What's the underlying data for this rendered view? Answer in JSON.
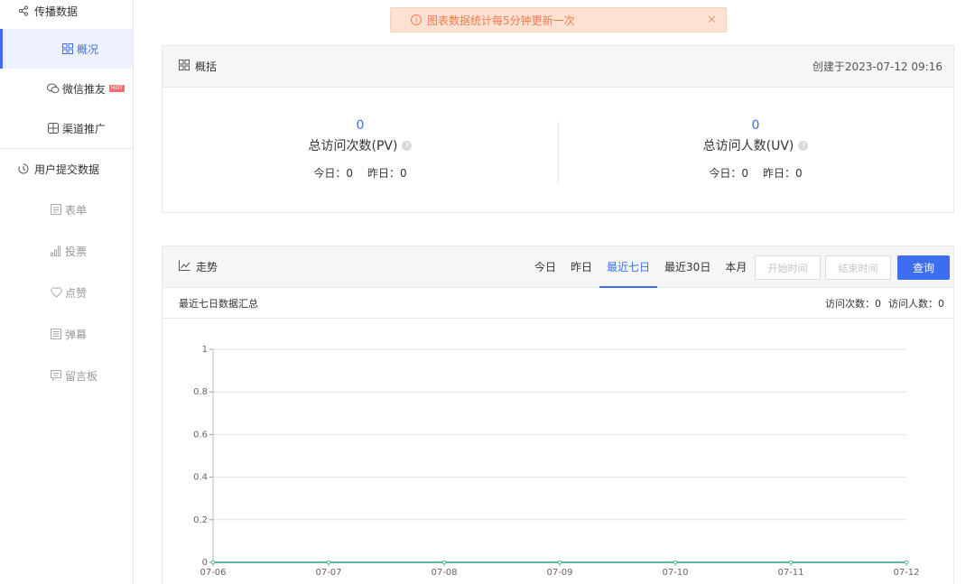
{
  "sidebar": {
    "section1": {
      "label": "传播数据",
      "icon": "share-icon"
    },
    "items1": [
      {
        "label": "概况",
        "icon": "grid-icon",
        "active": true
      },
      {
        "label": "微信推友",
        "icon": "wechat-icon",
        "badge": "HOT"
      },
      {
        "label": "渠道推广",
        "icon": "channel-icon"
      }
    ],
    "section2": {
      "label": "用户提交数据",
      "icon": "clock-icon"
    },
    "items2": [
      {
        "label": "表单",
        "icon": "form-icon"
      },
      {
        "label": "投票",
        "icon": "bar-chart-icon"
      },
      {
        "label": "点赞",
        "icon": "heart-icon"
      },
      {
        "label": "弹幕",
        "icon": "barrage-icon"
      },
      {
        "label": "留言板",
        "icon": "message-icon"
      }
    ]
  },
  "notice": {
    "text": "图表数据统计每5分钟更新一次"
  },
  "overview": {
    "title": "概括",
    "created": "创建于2023-07-12 09:16",
    "pv": {
      "value": "0",
      "label": "总访问次数(PV)",
      "today": "今日：0",
      "yesterday": "昨日：0"
    },
    "uv": {
      "value": "0",
      "label": "总访问人数(UV)",
      "today": "今日：0",
      "yesterday": "昨日：0"
    }
  },
  "trend": {
    "title": "走势",
    "ranges": [
      "今日",
      "昨日",
      "最近七日",
      "最近30日",
      "本月"
    ],
    "active_range": "最近七日",
    "start_placeholder": "开始时间",
    "end_placeholder": "结束时间",
    "query_label": "查询",
    "summary_title": "最近七日数据汇总",
    "visits": "访问次数：0",
    "visitors": "访问人数：0"
  },
  "chart_data": {
    "type": "line",
    "categories": [
      "07-06",
      "07-07",
      "07-08",
      "07-09",
      "07-10",
      "07-11",
      "07-12"
    ],
    "series": [
      {
        "values": [
          0,
          0,
          0,
          0,
          0,
          0,
          0
        ],
        "color": "#5ab7a0"
      }
    ],
    "ylim": [
      0,
      1
    ],
    "yticks": [
      "0",
      "0.2",
      "0.4",
      "0.6",
      "0.8",
      "1"
    ],
    "grid": true
  },
  "colors": {
    "accent": "#3d6ef0",
    "notice_bg": "#fde2d3",
    "notice_text": "#f27a4a"
  }
}
